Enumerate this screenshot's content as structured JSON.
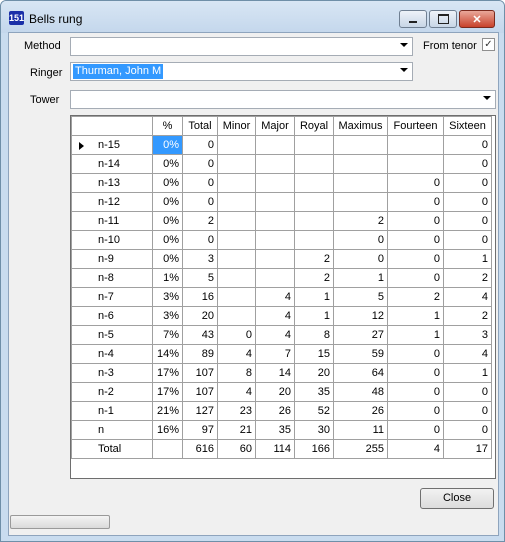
{
  "window": {
    "title": "Bells rung",
    "app_icon_text": "151",
    "minimize_icon": "minimize-icon",
    "maximize_icon": "maximize-icon",
    "close_icon": "close-icon"
  },
  "filters": {
    "method_label": "Method",
    "method_value": "",
    "from_tenor_label": "From tenor",
    "from_tenor_checked": true,
    "ringer_label": "Ringer",
    "ringer_value": "Thurman, John M",
    "tower_label": "Tower",
    "tower_value": ""
  },
  "table": {
    "columns": [
      "",
      "%",
      "Total",
      "Minor",
      "Major",
      "Royal",
      "Maximus",
      "Fourteen",
      "Sixteen"
    ],
    "rows": [
      [
        "n-15",
        "0%",
        "0",
        "",
        "",
        "",
        "",
        "",
        "0"
      ],
      [
        "n-14",
        "0%",
        "0",
        "",
        "",
        "",
        "",
        "",
        "0"
      ],
      [
        "n-13",
        "0%",
        "0",
        "",
        "",
        "",
        "",
        "0",
        "0"
      ],
      [
        "n-12",
        "0%",
        "0",
        "",
        "",
        "",
        "",
        "0",
        "0"
      ],
      [
        "n-11",
        "0%",
        "2",
        "",
        "",
        "",
        "2",
        "0",
        "0"
      ],
      [
        "n-10",
        "0%",
        "0",
        "",
        "",
        "",
        "0",
        "0",
        "0"
      ],
      [
        "n-9",
        "0%",
        "3",
        "",
        "",
        "2",
        "0",
        "0",
        "1"
      ],
      [
        "n-8",
        "1%",
        "5",
        "",
        "",
        "2",
        "1",
        "0",
        "2"
      ],
      [
        "n-7",
        "3%",
        "16",
        "",
        "4",
        "1",
        "5",
        "2",
        "4"
      ],
      [
        "n-6",
        "3%",
        "20",
        "",
        "4",
        "1",
        "12",
        "1",
        "2"
      ],
      [
        "n-5",
        "7%",
        "43",
        "0",
        "4",
        "8",
        "27",
        "1",
        "3"
      ],
      [
        "n-4",
        "14%",
        "89",
        "4",
        "7",
        "15",
        "59",
        "0",
        "4"
      ],
      [
        "n-3",
        "17%",
        "107",
        "8",
        "14",
        "20",
        "64",
        "0",
        "1"
      ],
      [
        "n-2",
        "17%",
        "107",
        "4",
        "20",
        "35",
        "48",
        "0",
        "0"
      ],
      [
        "n-1",
        "21%",
        "127",
        "23",
        "26",
        "52",
        "26",
        "0",
        "0"
      ],
      [
        "n",
        "16%",
        "97",
        "21",
        "35",
        "30",
        "11",
        "0",
        "0"
      ],
      [
        "Total",
        "",
        "616",
        "60",
        "114",
        "166",
        "255",
        "4",
        "17"
      ]
    ],
    "selected_row": 0
  },
  "buttons": {
    "close": "Close"
  }
}
